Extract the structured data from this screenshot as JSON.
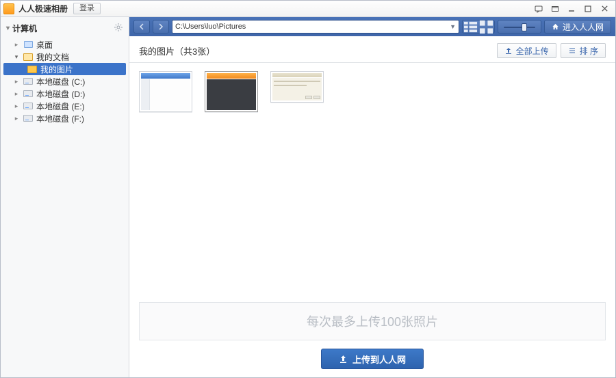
{
  "titlebar": {
    "app_name": "人人极速相册",
    "login": "登录"
  },
  "sidebar": {
    "header": "计算机",
    "items": [
      {
        "label": "桌面",
        "icon": "desktop"
      },
      {
        "label": "我的文档",
        "icon": "docs"
      },
      {
        "label": "我的图片",
        "icon": "pics",
        "selected": true
      },
      {
        "label": "本地磁盘 (C:)",
        "icon": "drive"
      },
      {
        "label": "本地磁盘 (D:)",
        "icon": "drive"
      },
      {
        "label": "本地磁盘 (E:)",
        "icon": "drive"
      },
      {
        "label": "本地磁盘 (F:)",
        "icon": "drive"
      }
    ]
  },
  "toolbar": {
    "path": "C:\\Users\\luo\\Pictures",
    "enter_site": "进入人人网"
  },
  "content": {
    "title": "我的图片（共3张）",
    "upload_all": "全部上传",
    "sort": "排 序"
  },
  "dropzone": {
    "hint": "每次最多上传100张照片"
  },
  "upload": {
    "label": "上传到人人网"
  }
}
